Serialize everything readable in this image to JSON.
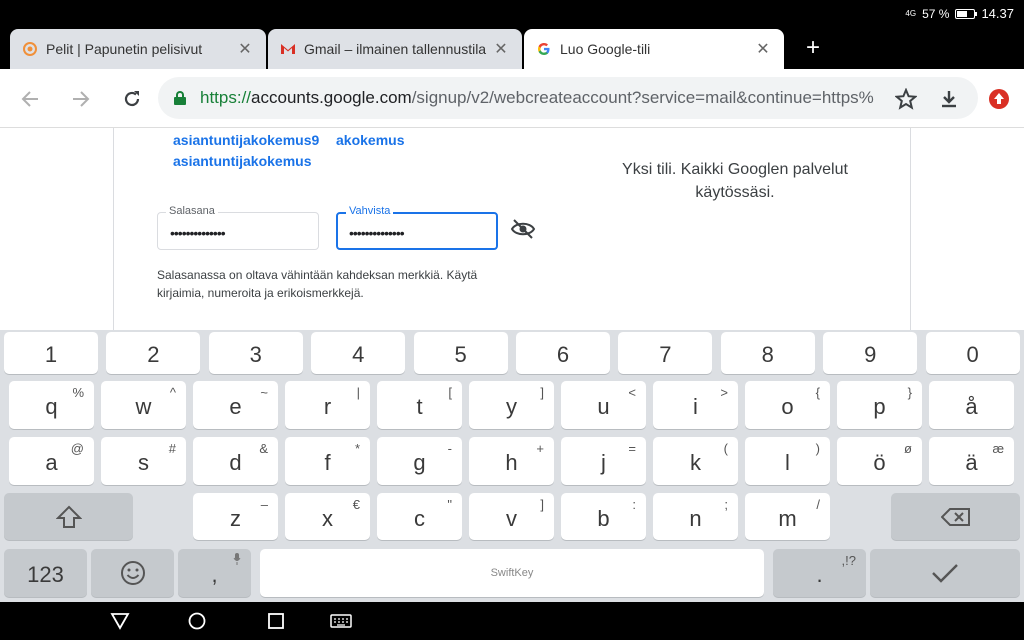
{
  "status_bar": {
    "signal": "4G",
    "battery": "57 %",
    "battery_level": 0.57,
    "time": "14.37"
  },
  "tabs": [
    {
      "title": "Pelit | Papunetin pelisivut",
      "favicon": "papunet-icon"
    },
    {
      "title": "Gmail – ilmainen tallennustila",
      "favicon": "gmail-icon"
    },
    {
      "title": "Luo Google-tili",
      "favicon": "google-icon",
      "active": true
    }
  ],
  "new_tab_label": "+",
  "omnibox": {
    "scheme": "https://",
    "host": "accounts.google.com",
    "path": "/signup/v2/webcreateaccount?service=mail&continue=https%"
  },
  "page": {
    "suggestions": [
      "asiantuntijakokemus9",
      "akokemus",
      "asiantuntijakokemus"
    ],
    "tagline_line1": "Yksi tili. Kaikki Googlen palvelut",
    "tagline_line2": "käytössäsi.",
    "password_label": "Salasana",
    "password_value": "••••••••••••••",
    "confirm_label": "Vahvista",
    "confirm_value": "••••••••••••••",
    "hint_line1": "Salasanassa on oltava vähintään kahdeksan merkkiä. Käytä",
    "hint_line2": "kirjaimia, numeroita ja erikoismerkkejä."
  },
  "keyboard": {
    "numbers": [
      "1",
      "2",
      "3",
      "4",
      "5",
      "6",
      "7",
      "8",
      "9",
      "0"
    ],
    "row1": [
      [
        "q",
        "%"
      ],
      [
        "w",
        "^"
      ],
      [
        "e",
        "~"
      ],
      [
        "r",
        "|"
      ],
      [
        "t",
        "["
      ],
      [
        "y",
        "]"
      ],
      [
        "u",
        "<"
      ],
      [
        "i",
        ">"
      ],
      [
        "o",
        "{"
      ],
      [
        "p",
        "}"
      ],
      [
        "å",
        ""
      ]
    ],
    "row2": [
      [
        "a",
        "@"
      ],
      [
        "s",
        "#"
      ],
      [
        "d",
        "&"
      ],
      [
        "f",
        "*"
      ],
      [
        "g",
        "-"
      ],
      [
        "h",
        "+"
      ],
      [
        "j",
        "="
      ],
      [
        "k",
        "("
      ],
      [
        "l",
        ")"
      ],
      [
        "ö",
        "ø"
      ],
      [
        "ä",
        "æ"
      ]
    ],
    "row3": [
      [
        "z",
        "–"
      ],
      [
        "x",
        "€"
      ],
      [
        "c",
        "\""
      ],
      [
        "v",
        "]"
      ],
      [
        "b",
        ":"
      ],
      [
        "n",
        ";"
      ],
      [
        "m",
        "/"
      ]
    ],
    "sym_key": "123",
    "comma": ",",
    "period": ".",
    "period_sub": ",!?",
    "space_label": "SwiftKey"
  }
}
